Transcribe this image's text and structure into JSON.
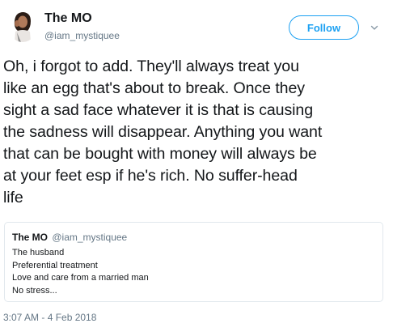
{
  "author": {
    "name": "The MO",
    "handle": "@iam_mystiquee"
  },
  "follow_button_label": "Follow",
  "more_menu_icon": "chevron-down-icon",
  "tweet_text_lines": [
    "Oh, i forgot to add. They'll always treat you",
    "like an egg that's about to break. Once they",
    "sight a sad face whatever it is that is causing",
    "the sadness will disappear. Anything you want",
    "that can be bought with money will always be",
    "at your feet esp if he's rich. No suffer-head",
    "life"
  ],
  "quoted_tweet": {
    "name": "The MO",
    "handle": "@iam_mystiquee",
    "lines": [
      "The husband",
      "Preferential treatment",
      "Love and care from a married man",
      "No stress..."
    ]
  },
  "timestamp": "3:07 AM - 4 Feb 2018",
  "colors": {
    "accent": "#1da1f2",
    "text": "#14171a",
    "secondary_text": "#657786",
    "border": "#e1e8ed"
  }
}
